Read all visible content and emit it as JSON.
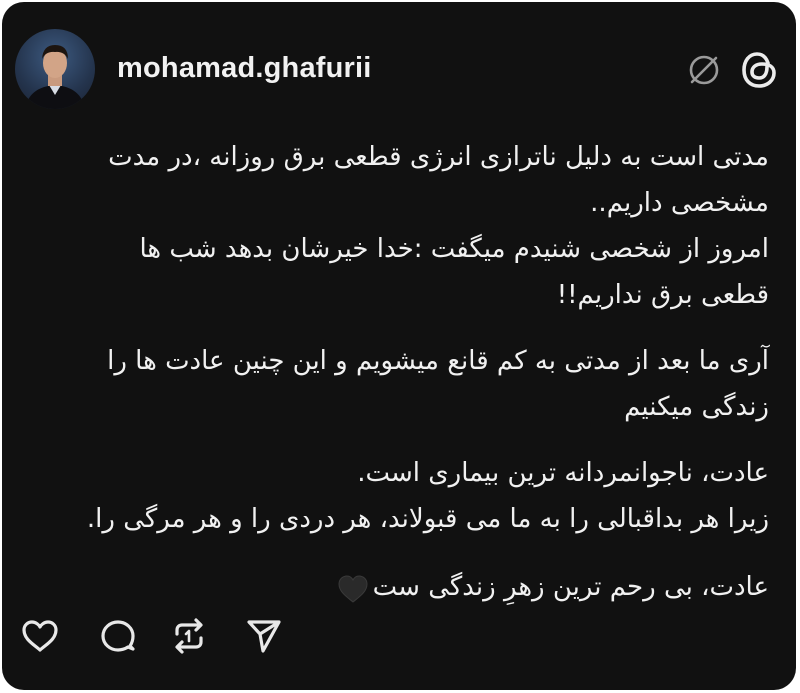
{
  "post": {
    "username": "mohamad.ghafurii",
    "paragraphs": [
      "مدتی است به دلیل ناترازی انرژی قطعی برق روزانه ،در مدت\nمشخصی داریم..",
      "امروز از شخصی شنیدم میگفت :خدا خیرشان بدهد شب ها\nقطعی برق نداریم!!",
      "آری ما بعد از مدتی به کم قانع میشویم و این چنین عادت ها را\nزندگی میکنیم",
      "عادت، ناجوانمردانه ترین بیماری است.\nزیرا هر بداقبالی را به ما می قبولاند، هر دردی را و هر مرگی را.",
      "عادت، بی رحم ترین زهرِ زندگی ست"
    ]
  },
  "icons": {
    "avatar": "profile-photo",
    "verified": "verified-badge-icon",
    "brand": "threads-logo-icon",
    "emoji": "black-heart-emoji",
    "actions": [
      "heart-icon",
      "comment-icon",
      "repost-icon",
      "share-icon"
    ]
  },
  "colors": {
    "background": "#111111",
    "text": "#f1f1f1",
    "icon": "#e8e8e8",
    "muted_icon": "#9a9a9a"
  }
}
